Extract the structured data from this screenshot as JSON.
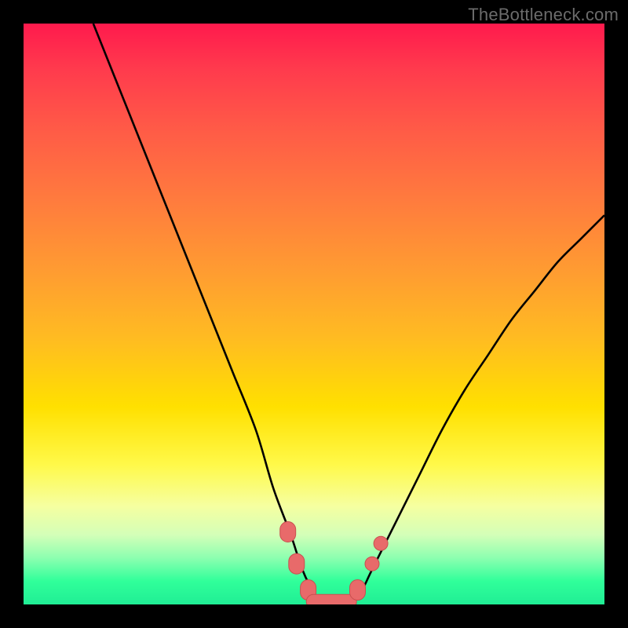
{
  "watermark": "TheBottleneck.com",
  "colors": {
    "background_frame": "#000000",
    "curve_stroke": "#000000",
    "marker_fill": "#e86a6a",
    "marker_stroke": "#c94f4f"
  },
  "chart_data": {
    "type": "line",
    "title": "",
    "xlabel": "",
    "ylabel": "",
    "xlim": [
      0,
      100
    ],
    "ylim": [
      0,
      100
    ],
    "series": [
      {
        "name": "bottleneck-curve",
        "x": [
          12,
          16,
          20,
          24,
          28,
          32,
          36,
          40,
          43,
          46,
          48,
          50,
          52,
          54,
          56,
          58,
          60,
          64,
          68,
          72,
          76,
          80,
          84,
          88,
          92,
          96,
          100
        ],
        "y": [
          100,
          90,
          80,
          70,
          60,
          50,
          40,
          30,
          20,
          12,
          6,
          2,
          0,
          0,
          0,
          2,
          6,
          14,
          22,
          30,
          37,
          43,
          49,
          54,
          59,
          63,
          67
        ]
      }
    ],
    "markers": [
      {
        "x": 45.5,
        "y": 12.5,
        "shape": "rounded"
      },
      {
        "x": 47.0,
        "y": 7.0,
        "shape": "rounded"
      },
      {
        "x": 49.0,
        "y": 2.5,
        "shape": "rounded"
      },
      {
        "x": 53.0,
        "y": 0.5,
        "shape": "pill-wide"
      },
      {
        "x": 57.5,
        "y": 2.5,
        "shape": "rounded"
      },
      {
        "x": 60.0,
        "y": 7.0,
        "shape": "dot"
      },
      {
        "x": 61.5,
        "y": 10.5,
        "shape": "dot"
      }
    ],
    "legend": null,
    "grid": false
  }
}
